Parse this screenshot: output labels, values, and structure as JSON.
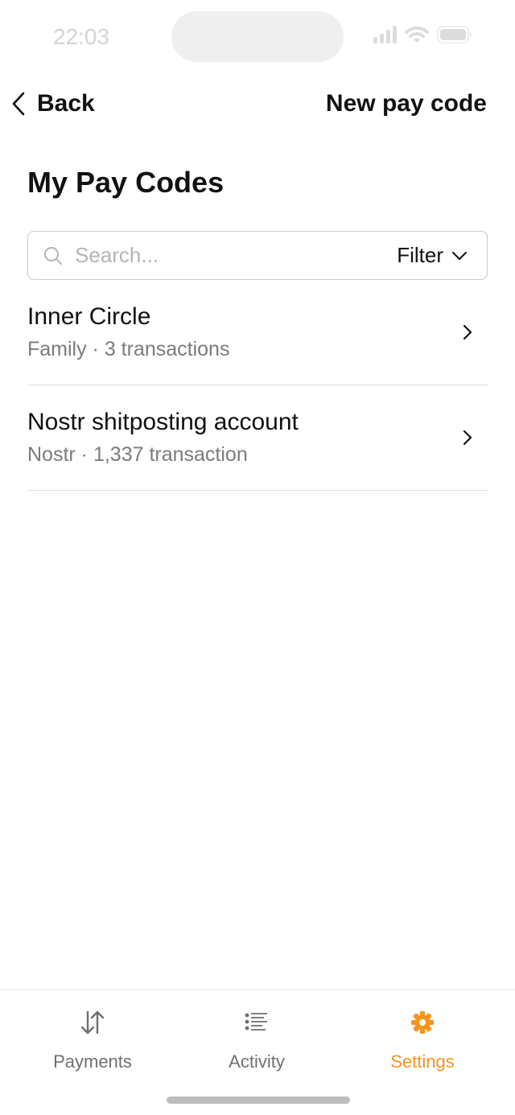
{
  "status_bar": {
    "time": "22:03"
  },
  "nav": {
    "back_label": "Back",
    "action_label": "New pay code"
  },
  "page": {
    "title": "My Pay Codes"
  },
  "search": {
    "placeholder": "Search...",
    "value": "",
    "filter_label": "Filter"
  },
  "pay_codes": [
    {
      "name": "Inner Circle",
      "subtitle": "Family · 3 transactions"
    },
    {
      "name": "Nostr shitposting account",
      "subtitle": "Nostr · 1,337 transaction"
    }
  ],
  "tabs": [
    {
      "label": "Payments",
      "icon": "arrows-up-down-icon",
      "active": false
    },
    {
      "label": "Activity",
      "icon": "list-icon",
      "active": false
    },
    {
      "label": "Settings",
      "icon": "gear-icon",
      "active": true
    }
  ],
  "colors": {
    "accent": "#f7931a",
    "muted_text": "#7b7b7b",
    "divider": "#dcdcdc"
  }
}
